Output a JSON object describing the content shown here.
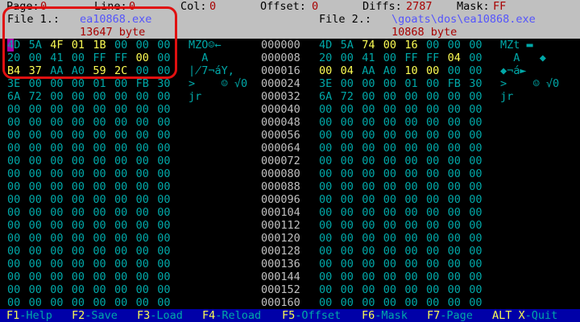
{
  "status": {
    "page_label": "Page:",
    "page_value": "0",
    "line_label": "Line:",
    "line_value": "0",
    "col_label": "Col:",
    "col_value": "0",
    "offset_label": "Offset:",
    "offset_value": "0",
    "diffs_label": "Diffs:",
    "diffs_value": "2787",
    "mask_label": "Mask:",
    "mask_value": "FF"
  },
  "file1": {
    "label": "File 1.:",
    "name": "ea10868.exe",
    "size": "13647 byte"
  },
  "file2": {
    "label": "File 2.:",
    "name": "\\goats\\dos\\ea10868.exe",
    "size": "10868 byte"
  },
  "rows": [
    {
      "off": "000000",
      "left": [
        "4D",
        "5A",
        "4F",
        "01",
        "1B",
        "00",
        "00",
        "00"
      ],
      "right": [
        "4D",
        "5A",
        "74",
        "00",
        "16",
        "00",
        "00",
        "00"
      ],
      "lasc": "MZO☺←",
      "rasc": "MZt ▬",
      "ldiff": [
        2,
        3,
        4
      ],
      "rdiff": [
        2,
        3,
        4
      ],
      "cursor": true
    },
    {
      "off": "000008",
      "left": [
        "20",
        "00",
        "41",
        "00",
        "FF",
        "FF",
        "00",
        "00"
      ],
      "right": [
        "20",
        "00",
        "41",
        "00",
        "FF",
        "FF",
        "04",
        "00"
      ],
      "lasc": "  A",
      "rasc": "  A   ◆",
      "ldiff": [
        6
      ],
      "rdiff": [
        6
      ],
      "cursor": false
    },
    {
      "off": "000016",
      "left": [
        "B4",
        "37",
        "AA",
        "A0",
        "59",
        "2C",
        "00",
        "00"
      ],
      "right": [
        "00",
        "04",
        "AA",
        "A0",
        "10",
        "00",
        "00",
        "00"
      ],
      "lasc": "∤7¬áY,",
      "rasc": "◆¬á►",
      "ldiff": [
        0,
        1,
        4,
        5
      ],
      "rdiff": [
        0,
        1,
        4,
        5
      ],
      "cursor": false
    },
    {
      "off": "000024",
      "left": [
        "3E",
        "00",
        "00",
        "00",
        "01",
        "00",
        "FB",
        "30"
      ],
      "right": [
        "3E",
        "00",
        "00",
        "00",
        "01",
        "00",
        "FB",
        "30"
      ],
      "lasc": ">    ☺ √0",
      "rasc": ">    ☺ √0",
      "ldiff": [],
      "rdiff": [],
      "cursor": false
    },
    {
      "off": "000032",
      "left": [
        "6A",
        "72",
        "00",
        "00",
        "00",
        "00",
        "00",
        "00"
      ],
      "right": [
        "6A",
        "72",
        "00",
        "00",
        "00",
        "00",
        "00",
        "00"
      ],
      "lasc": "jr",
      "rasc": "jr",
      "ldiff": [],
      "rdiff": [],
      "cursor": false
    },
    {
      "off": "000040",
      "left": [
        "00",
        "00",
        "00",
        "00",
        "00",
        "00",
        "00",
        "00"
      ],
      "right": [
        "00",
        "00",
        "00",
        "00",
        "00",
        "00",
        "00",
        "00"
      ],
      "lasc": "",
      "rasc": "",
      "ldiff": [],
      "rdiff": [],
      "cursor": false
    },
    {
      "off": "000048",
      "left": [
        "00",
        "00",
        "00",
        "00",
        "00",
        "00",
        "00",
        "00"
      ],
      "right": [
        "00",
        "00",
        "00",
        "00",
        "00",
        "00",
        "00",
        "00"
      ],
      "lasc": "",
      "rasc": "",
      "ldiff": [],
      "rdiff": [],
      "cursor": false
    },
    {
      "off": "000056",
      "left": [
        "00",
        "00",
        "00",
        "00",
        "00",
        "00",
        "00",
        "00"
      ],
      "right": [
        "00",
        "00",
        "00",
        "00",
        "00",
        "00",
        "00",
        "00"
      ],
      "lasc": "",
      "rasc": "",
      "ldiff": [],
      "rdiff": [],
      "cursor": false
    },
    {
      "off": "000064",
      "left": [
        "00",
        "00",
        "00",
        "00",
        "00",
        "00",
        "00",
        "00"
      ],
      "right": [
        "00",
        "00",
        "00",
        "00",
        "00",
        "00",
        "00",
        "00"
      ],
      "lasc": "",
      "rasc": "",
      "ldiff": [],
      "rdiff": [],
      "cursor": false
    },
    {
      "off": "000072",
      "left": [
        "00",
        "00",
        "00",
        "00",
        "00",
        "00",
        "00",
        "00"
      ],
      "right": [
        "00",
        "00",
        "00",
        "00",
        "00",
        "00",
        "00",
        "00"
      ],
      "lasc": "",
      "rasc": "",
      "ldiff": [],
      "rdiff": [],
      "cursor": false
    },
    {
      "off": "000080",
      "left": [
        "00",
        "00",
        "00",
        "00",
        "00",
        "00",
        "00",
        "00"
      ],
      "right": [
        "00",
        "00",
        "00",
        "00",
        "00",
        "00",
        "00",
        "00"
      ],
      "lasc": "",
      "rasc": "",
      "ldiff": [],
      "rdiff": [],
      "cursor": false
    },
    {
      "off": "000088",
      "left": [
        "00",
        "00",
        "00",
        "00",
        "00",
        "00",
        "00",
        "00"
      ],
      "right": [
        "00",
        "00",
        "00",
        "00",
        "00",
        "00",
        "00",
        "00"
      ],
      "lasc": "",
      "rasc": "",
      "ldiff": [],
      "rdiff": [],
      "cursor": false
    },
    {
      "off": "000096",
      "left": [
        "00",
        "00",
        "00",
        "00",
        "00",
        "00",
        "00",
        "00"
      ],
      "right": [
        "00",
        "00",
        "00",
        "00",
        "00",
        "00",
        "00",
        "00"
      ],
      "lasc": "",
      "rasc": "",
      "ldiff": [],
      "rdiff": [],
      "cursor": false
    },
    {
      "off": "000104",
      "left": [
        "00",
        "00",
        "00",
        "00",
        "00",
        "00",
        "00",
        "00"
      ],
      "right": [
        "00",
        "00",
        "00",
        "00",
        "00",
        "00",
        "00",
        "00"
      ],
      "lasc": "",
      "rasc": "",
      "ldiff": [],
      "rdiff": [],
      "cursor": false
    },
    {
      "off": "000112",
      "left": [
        "00",
        "00",
        "00",
        "00",
        "00",
        "00",
        "00",
        "00"
      ],
      "right": [
        "00",
        "00",
        "00",
        "00",
        "00",
        "00",
        "00",
        "00"
      ],
      "lasc": "",
      "rasc": "",
      "ldiff": [],
      "rdiff": [],
      "cursor": false
    },
    {
      "off": "000120",
      "left": [
        "00",
        "00",
        "00",
        "00",
        "00",
        "00",
        "00",
        "00"
      ],
      "right": [
        "00",
        "00",
        "00",
        "00",
        "00",
        "00",
        "00",
        "00"
      ],
      "lasc": "",
      "rasc": "",
      "ldiff": [],
      "rdiff": [],
      "cursor": false
    },
    {
      "off": "000128",
      "left": [
        "00",
        "00",
        "00",
        "00",
        "00",
        "00",
        "00",
        "00"
      ],
      "right": [
        "00",
        "00",
        "00",
        "00",
        "00",
        "00",
        "00",
        "00"
      ],
      "lasc": "",
      "rasc": "",
      "ldiff": [],
      "rdiff": [],
      "cursor": false
    },
    {
      "off": "000136",
      "left": [
        "00",
        "00",
        "00",
        "00",
        "00",
        "00",
        "00",
        "00"
      ],
      "right": [
        "00",
        "00",
        "00",
        "00",
        "00",
        "00",
        "00",
        "00"
      ],
      "lasc": "",
      "rasc": "",
      "ldiff": [],
      "rdiff": [],
      "cursor": false
    },
    {
      "off": "000144",
      "left": [
        "00",
        "00",
        "00",
        "00",
        "00",
        "00",
        "00",
        "00"
      ],
      "right": [
        "00",
        "00",
        "00",
        "00",
        "00",
        "00",
        "00",
        "00"
      ],
      "lasc": "",
      "rasc": "",
      "ldiff": [],
      "rdiff": [],
      "cursor": false
    },
    {
      "off": "000152",
      "left": [
        "00",
        "00",
        "00",
        "00",
        "00",
        "00",
        "00",
        "00"
      ],
      "right": [
        "00",
        "00",
        "00",
        "00",
        "00",
        "00",
        "00",
        "00"
      ],
      "lasc": "",
      "rasc": "",
      "ldiff": [],
      "rdiff": [],
      "cursor": false
    },
    {
      "off": "000160",
      "left": [
        "00",
        "00",
        "00",
        "00",
        "00",
        "00",
        "00",
        "00"
      ],
      "right": [
        "00",
        "00",
        "00",
        "00",
        "00",
        "00",
        "00",
        "00"
      ],
      "lasc": "",
      "rasc": "",
      "ldiff": [],
      "rdiff": [],
      "cursor": false
    }
  ],
  "footer": [
    {
      "key": "F1",
      "label": "-Help"
    },
    {
      "key": "F2",
      "label": "-Save"
    },
    {
      "key": "F3",
      "label": "-Load"
    },
    {
      "key": "F4",
      "label": "-Reload"
    },
    {
      "key": "F5",
      "label": "-Offset"
    },
    {
      "key": "F6",
      "label": "-Mask"
    },
    {
      "key": "F7",
      "label": "-Page"
    },
    {
      "key": "ALT X",
      "label": "-Quit"
    }
  ],
  "colors": {
    "highlight_box": "#e01010",
    "changed_byte": "#fcfc54",
    "normal_byte": "#00a8a8",
    "cursor": "#a800a8"
  }
}
